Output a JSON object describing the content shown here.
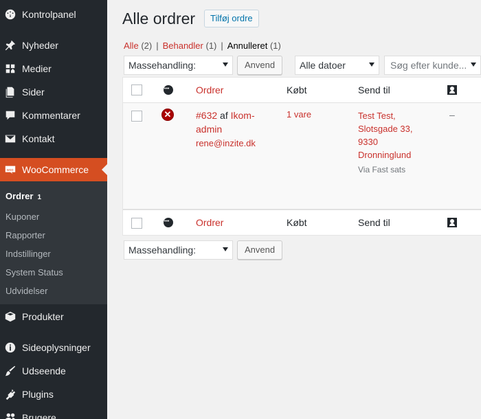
{
  "sidebar": {
    "items": [
      {
        "label": "Kontrolpanel",
        "icon": "dashboard-icon"
      },
      {
        "label": "Nyheder",
        "icon": "pin-icon"
      },
      {
        "label": "Medier",
        "icon": "media-icon"
      },
      {
        "label": "Sider",
        "icon": "pages-icon"
      },
      {
        "label": "Kommentarer",
        "icon": "comment-icon"
      },
      {
        "label": "Kontakt",
        "icon": "mail-icon"
      },
      {
        "label": "WooCommerce",
        "icon": "woocommerce-icon"
      },
      {
        "label": "Produkter",
        "icon": "box-icon"
      },
      {
        "label": "Sideoplysninger",
        "icon": "info-icon"
      },
      {
        "label": "Udseende",
        "icon": "brush-icon"
      },
      {
        "label": "Plugins",
        "icon": "plugin-icon"
      },
      {
        "label": "Brugere",
        "icon": "users-icon"
      }
    ],
    "submenu": [
      {
        "label": "Ordrer",
        "count": "1"
      },
      {
        "label": "Kuponer"
      },
      {
        "label": "Rapporter"
      },
      {
        "label": "Indstillinger"
      },
      {
        "label": "System Status"
      },
      {
        "label": "Udvidelser"
      }
    ]
  },
  "page": {
    "title": "Alle ordrer",
    "add_button": "Tilføj ordre"
  },
  "views": {
    "all": "Alle",
    "all_count": "(2)",
    "processing": "Behandler",
    "processing_count": "(1)",
    "cancelled": "Annulleret",
    "cancelled_count": "(1)",
    "separator": "|"
  },
  "filters": {
    "bulk_action": "Massehandling:",
    "apply": "Anvend",
    "dates": "Alle datoer",
    "search_placeholder": "Søg efter kunde..."
  },
  "table": {
    "columns": {
      "orders": "Ordrer",
      "purchased": "Købt",
      "ship_to": "Send til"
    },
    "rows": [
      {
        "order": "#632",
        "by": "af",
        "customer": "Ikom-admin",
        "email": "rene@inzite.dk",
        "purchased": "1 vare",
        "ship_lines": [
          "Test Test,",
          "Slotsgade 33,",
          "9330",
          "Dronninglund"
        ],
        "ship_via": "Via Fast sats",
        "extra": "–",
        "status": "cancelled"
      }
    ]
  },
  "colors": {
    "sidebar": "#23282d",
    "active": "#d54e21",
    "link": "#c9312c",
    "submenu": "#32373c"
  }
}
